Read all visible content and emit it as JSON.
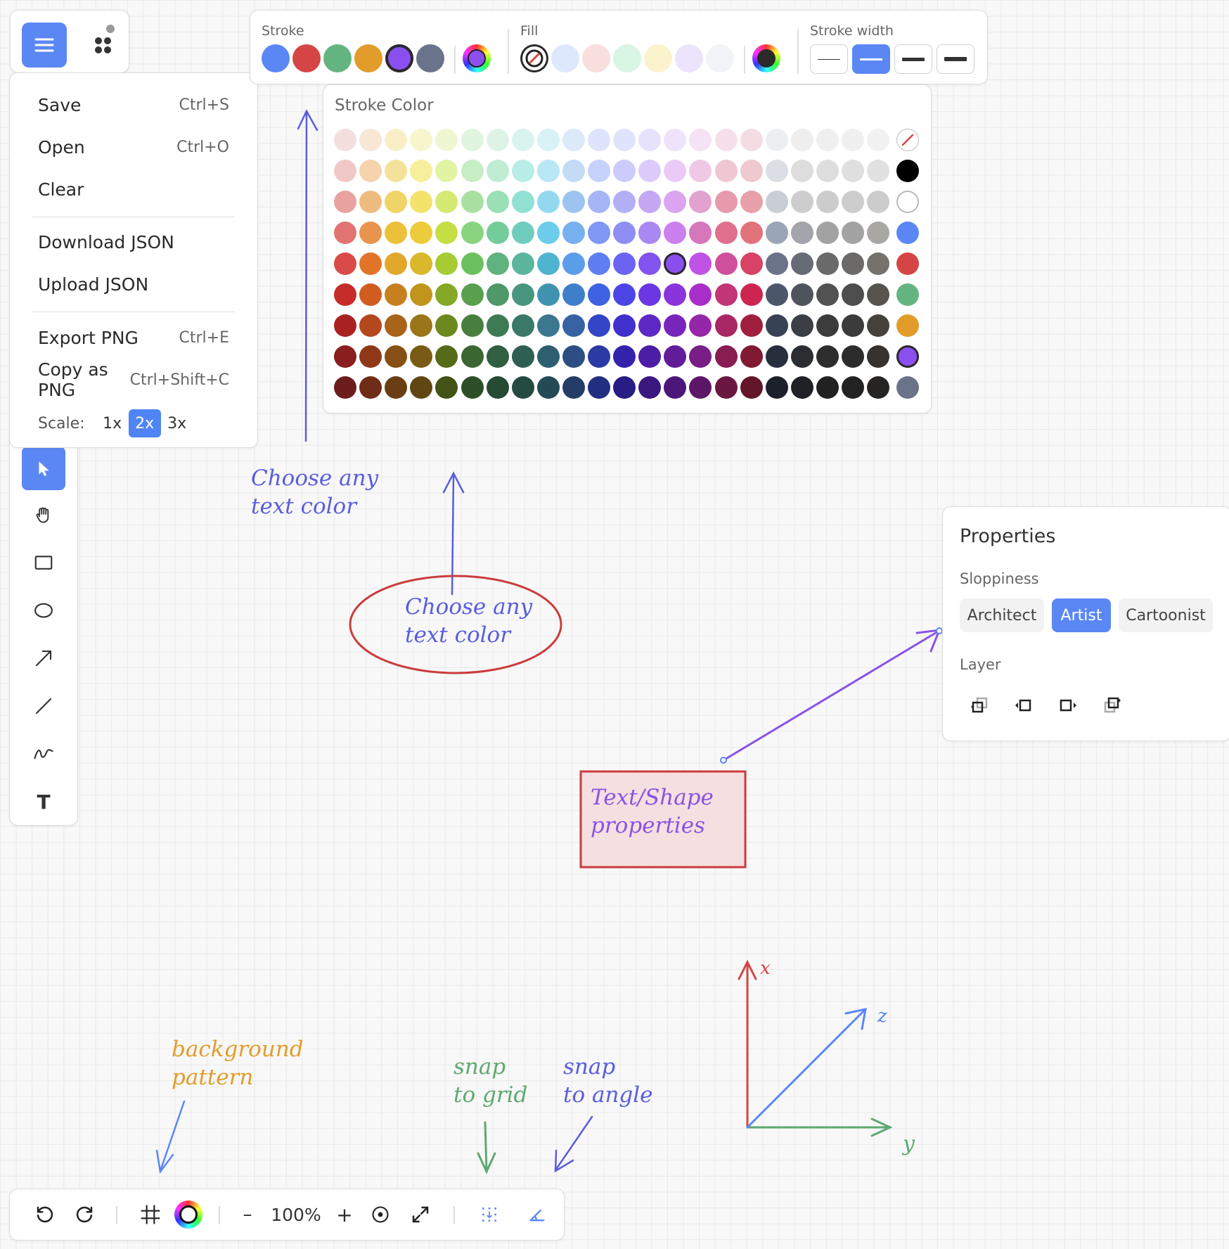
{
  "colors": {
    "accent": "#5b87f5",
    "stroke_selected": "#8b4ff0"
  },
  "menu": {
    "items": [
      {
        "label": "Save",
        "shortcut": "Ctrl+S"
      },
      {
        "label": "Open",
        "shortcut": "Ctrl+O"
      },
      {
        "label": "Clear",
        "shortcut": ""
      },
      {
        "label": "Download JSON",
        "shortcut": ""
      },
      {
        "label": "Upload JSON",
        "shortcut": ""
      },
      {
        "label": "Export PNG",
        "shortcut": "Ctrl+E"
      },
      {
        "label": "Copy as PNG",
        "shortcut": "Ctrl+Shift+C"
      }
    ],
    "scale_label": "Scale:",
    "scale_options": [
      "1x",
      "2x",
      "3x"
    ],
    "scale_selected": "2x"
  },
  "tools": [
    {
      "name": "select-tool",
      "icon": "cursor-icon",
      "active": true
    },
    {
      "name": "hand-tool",
      "icon": "hand-icon"
    },
    {
      "name": "rectangle-tool",
      "icon": "rectangle-icon"
    },
    {
      "name": "ellipse-tool",
      "icon": "ellipse-icon"
    },
    {
      "name": "arrow-tool",
      "icon": "arrow-icon"
    },
    {
      "name": "line-tool",
      "icon": "line-icon"
    },
    {
      "name": "freehand-tool",
      "icon": "freehand-icon"
    },
    {
      "name": "text-tool",
      "icon": "text-icon",
      "glyph": "T"
    }
  ],
  "style_bar": {
    "stroke_label": "Stroke",
    "fill_label": "Fill",
    "width_label": "Stroke width",
    "stroke_colors": [
      "#5b87f5",
      "#d64545",
      "#64b482",
      "#e29c2a",
      "#8b4ff0",
      "#6a7389"
    ],
    "stroke_selected_index": 4,
    "fill_colors": [
      "none",
      "#dde8fd",
      "#f8dedd",
      "#d9f5e3",
      "#fbf3cd",
      "#ece3fc",
      "#f1f3f6"
    ],
    "fill_selected_index": 0,
    "stroke_widths": [
      1,
      2,
      3,
      4
    ],
    "width_selected_index": 1
  },
  "palette": {
    "title": "Stroke Color",
    "rows": [
      [
        "#f4dfdf",
        "#f8e7d4",
        "#f9efc7",
        "#f7f6cb",
        "#eff7d2",
        "#dff5df",
        "#ddf3e6",
        "#d9f3ef",
        "#d8f2f6",
        "#dbe9f8",
        "#dde4fb",
        "#e0e3fc",
        "#e7e2fc",
        "#eee3fb",
        "#f6e2f5",
        "#f5e0e9",
        "#f4dde2",
        "#eceff2",
        "#eeeeef",
        "#efefef",
        "#f0f0f0",
        "#f1f1f1"
      ],
      [
        "#f0c9c7",
        "#f5d3ad",
        "#f5e29a",
        "#f7ef9c",
        "#e3f3a4",
        "#c6edc3",
        "#c0ecd3",
        "#b7ede6",
        "#b8e7f5",
        "#c3dbf5",
        "#c6d2fb",
        "#ccccfb",
        "#dccbfa",
        "#ebcaf8",
        "#efc8e5",
        "#efc7d2",
        "#eec9cf",
        "#dbdee5",
        "#dddddd",
        "#dddddd",
        "#dfdfdf",
        "#e1e1e1"
      ],
      [
        "#e8a3a0",
        "#eebc7f",
        "#f0d468",
        "#f3e26b",
        "#d4ea72",
        "#a9e0a1",
        "#9adfb5",
        "#91e1d3",
        "#92d9ef",
        "#9dc4f0",
        "#a5b5f5",
        "#b2aff7",
        "#c5a7f4",
        "#dba4f1",
        "#e1a2cf",
        "#e69aac",
        "#e7a0a8",
        "#c8cdd6",
        "#cdcdcd",
        "#cccccc",
        "#cdcdcd",
        "#cccccc"
      ],
      [
        "#e17472",
        "#e8944e",
        "#ebc13a",
        "#edcc3b",
        "#c5de44",
        "#88d47f",
        "#74cc9a",
        "#70cdbe",
        "#6cccea",
        "#77b0ee",
        "#7f98f3",
        "#8e8ef5",
        "#a888f2",
        "#cb80ed",
        "#d577ba",
        "#df6f8c",
        "#e2727c",
        "#9aa6b5",
        "#a2a5ab",
        "#a2a2a2",
        "#a3a3a3",
        "#a9a7a3"
      ],
      [
        "#d94b49",
        "#e27427",
        "#e3a72c",
        "#dbb82b",
        "#a7cb33",
        "#6bc15d",
        "#5fb37e",
        "#5cb59f",
        "#4fb4cf",
        "#5b9de8",
        "#5e7ef2",
        "#6c64f3",
        "#8154ef",
        "#8b4ff0",
        "#c052e6",
        "#cf4f9a",
        "#d84266",
        "#6a7389",
        "#676b76",
        "#6a6a6a",
        "#6b6a69",
        "#75716c"
      ],
      [
        "#c62d2a",
        "#d05c20",
        "#c7801f",
        "#c1941c",
        "#85a826",
        "#5aa04f",
        "#4f9868",
        "#49967f",
        "#3f93b0",
        "#3f7ec9",
        "#3d63e3",
        "#4c45e5",
        "#6a37e3",
        "#8a34da",
        "#a82ec9",
        "#c23577",
        "#cc2650",
        "#4d576b",
        "#4f535b",
        "#525252",
        "#4e4e4e",
        "#57534f"
      ],
      [
        "#a82222",
        "#b3481d",
        "#a86419",
        "#9b7519",
        "#6c881f",
        "#487f3e",
        "#3e7a54",
        "#3a7967",
        "#3b7890",
        "#3762a3",
        "#3346c7",
        "#4030cc",
        "#5d28c5",
        "#7725bb",
        "#9426a9",
        "#a82765",
        "#a01f3e",
        "#384255",
        "#3b3e45",
        "#3c3c3c",
        "#3b3b3b",
        "#45413d"
      ],
      [
        "#8a1e1e",
        "#8f3818",
        "#865014",
        "#7a5b14",
        "#566b19",
        "#3a6631",
        "#315f41",
        "#2f5f52",
        "#2e5f70",
        "#2d4e83",
        "#2b3aa4",
        "#3323aa",
        "#4c1ea5",
        "#611c99",
        "#781e86",
        "#881d52",
        "#801a33",
        "#272e3c",
        "#2b2d33",
        "#2d2d2d",
        "#2c2c2c",
        "#35322f"
      ],
      [
        "#6d1d1d",
        "#6f2c16",
        "#693e12",
        "#5f4612",
        "#435215",
        "#2d4f27",
        "#264a33",
        "#254a40",
        "#244a56",
        "#233d66",
        "#222e80",
        "#281c85",
        "#3b1880",
        "#4b1677",
        "#5d1769",
        "#6a1841",
        "#62162a",
        "#1b202b",
        "#1f2126",
        "#212121",
        "#222222",
        "#262423"
      ]
    ],
    "selected": [
      4,
      13
    ],
    "side_column": [
      "none",
      "#000000",
      "#ffffff",
      "#5b87f5",
      "#d64545",
      "#64b482",
      "#e29c2a",
      "#8b4ff0",
      "#6a7389"
    ],
    "side_selected_index": 7
  },
  "properties": {
    "title": "Properties",
    "sloppiness_label": "Sloppiness",
    "sloppiness_options": [
      "Architect",
      "Artist",
      "Cartoonist"
    ],
    "sloppiness_selected": "Artist",
    "layer_label": "Layer",
    "layer_buttons": [
      "send-to-back-icon",
      "send-backward-icon",
      "bring-forward-icon",
      "bring-to-front-icon"
    ]
  },
  "bottom_bar": {
    "zoom": "100%",
    "zoom_out": "–",
    "zoom_in": "+"
  },
  "canvas": {
    "note_left": "Choose any\ntext color",
    "ellipse_text": "Choose any\ntext color",
    "rect_text": "Text/Shape\nproperties",
    "bg_note": "background\npattern",
    "snap_grid_note": "snap\nto grid",
    "snap_angle_note": "snap\nto angle",
    "axis_x": "x",
    "axis_y": "y",
    "axis_z": "z"
  }
}
